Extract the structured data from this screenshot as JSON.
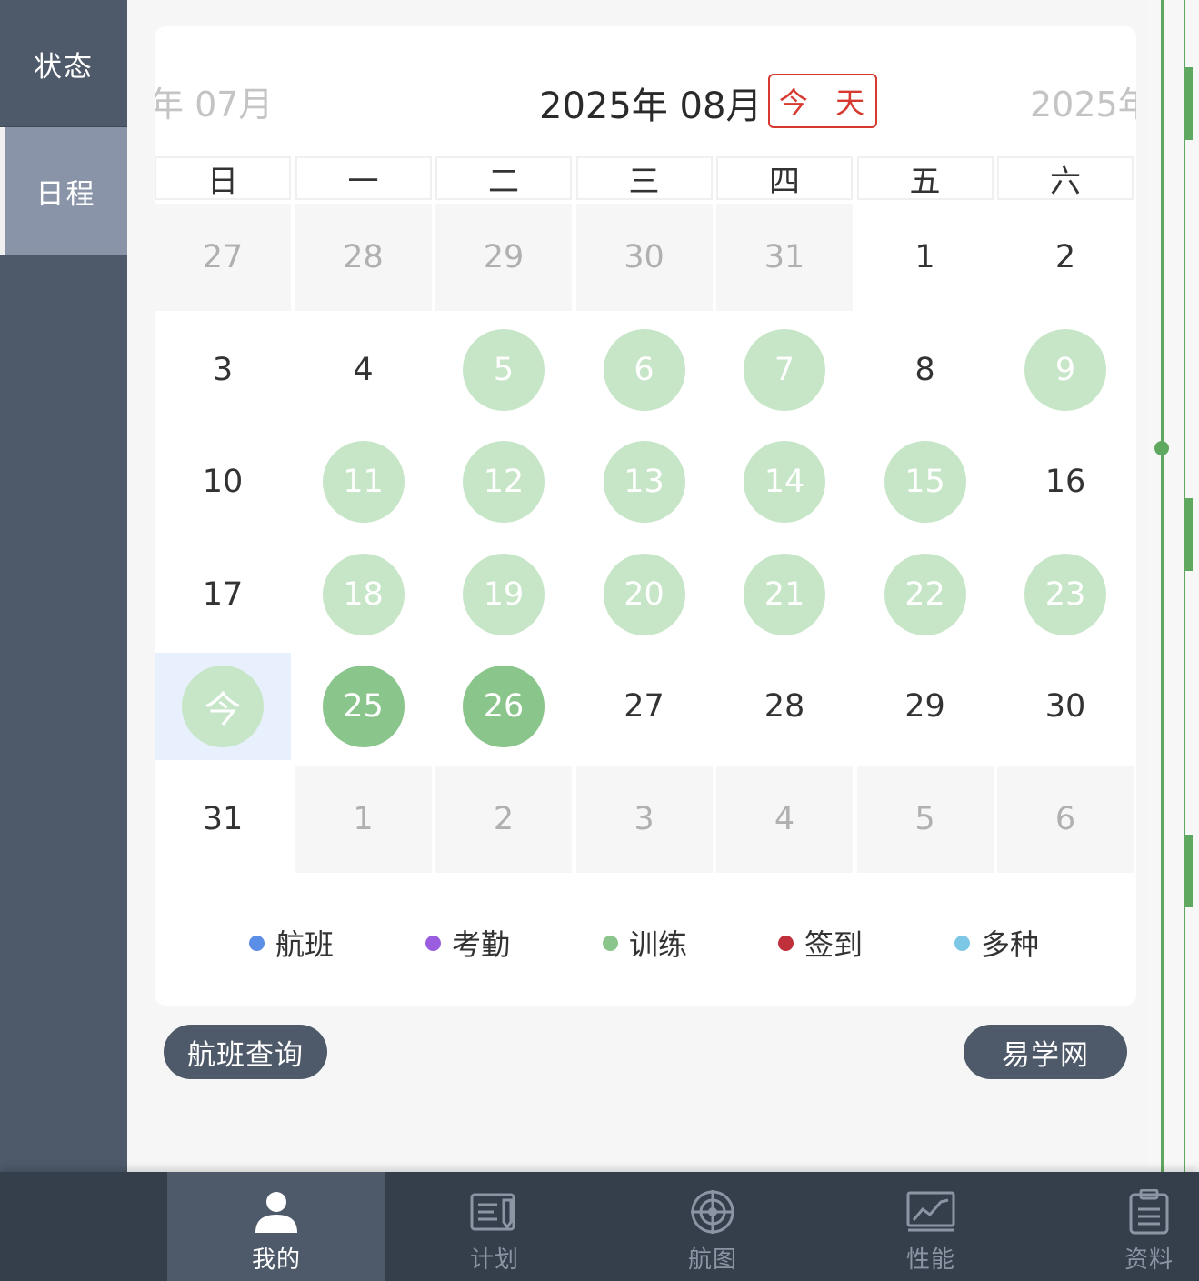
{
  "sidebar": {
    "items": [
      {
        "label": "状态"
      },
      {
        "label": "日程"
      }
    ]
  },
  "calendar": {
    "prev_month": "年 07月",
    "current_month": "2025年 08月",
    "next_month": "2025年",
    "today_button": "今 天",
    "weekdays": [
      "日",
      "一",
      "二",
      "三",
      "四",
      "五",
      "六"
    ],
    "rows": [
      [
        {
          "d": "27",
          "o": true
        },
        {
          "d": "28",
          "o": true
        },
        {
          "d": "29",
          "o": true
        },
        {
          "d": "30",
          "o": true
        },
        {
          "d": "31",
          "o": true
        },
        {
          "d": "1"
        },
        {
          "d": "2"
        }
      ],
      [
        {
          "d": "3"
        },
        {
          "d": "4"
        },
        {
          "d": "5",
          "m": "light"
        },
        {
          "d": "6",
          "m": "light"
        },
        {
          "d": "7",
          "m": "light"
        },
        {
          "d": "8"
        },
        {
          "d": "9",
          "m": "light"
        }
      ],
      [
        {
          "d": "10"
        },
        {
          "d": "11",
          "m": "light"
        },
        {
          "d": "12",
          "m": "light"
        },
        {
          "d": "13",
          "m": "light"
        },
        {
          "d": "14",
          "m": "light"
        },
        {
          "d": "15",
          "m": "light"
        },
        {
          "d": "16"
        }
      ],
      [
        {
          "d": "17"
        },
        {
          "d": "18",
          "m": "light"
        },
        {
          "d": "19",
          "m": "light"
        },
        {
          "d": "20",
          "m": "light"
        },
        {
          "d": "21",
          "m": "light"
        },
        {
          "d": "22",
          "m": "light"
        },
        {
          "d": "23",
          "m": "light"
        }
      ],
      [
        {
          "d": "今",
          "m": "todaymark",
          "today": true
        },
        {
          "d": "25",
          "m": "dark"
        },
        {
          "d": "26",
          "m": "dark"
        },
        {
          "d": "27"
        },
        {
          "d": "28"
        },
        {
          "d": "29"
        },
        {
          "d": "30"
        }
      ],
      [
        {
          "d": "31"
        },
        {
          "d": "1",
          "o": true
        },
        {
          "d": "2",
          "o": true
        },
        {
          "d": "3",
          "o": true
        },
        {
          "d": "4",
          "o": true
        },
        {
          "d": "5",
          "o": true
        },
        {
          "d": "6",
          "o": true
        }
      ]
    ]
  },
  "legend": [
    {
      "label": "航班",
      "color": "#5b8ee6"
    },
    {
      "label": "考勤",
      "color": "#9a5de0"
    },
    {
      "label": "训练",
      "color": "#8ac58b"
    },
    {
      "label": "签到",
      "color": "#c0303a"
    },
    {
      "label": "多种",
      "color": "#7cc6e6"
    }
  ],
  "actions": {
    "flight_query": "航班查询",
    "yixue": "易学网"
  },
  "tabs": [
    {
      "label": "我的",
      "icon": "person-icon",
      "active": true
    },
    {
      "label": "计划",
      "icon": "plan-icon"
    },
    {
      "label": "航图",
      "icon": "chart-target-icon"
    },
    {
      "label": "性能",
      "icon": "performance-icon"
    },
    {
      "label": "资料",
      "icon": "clipboard-icon"
    }
  ],
  "colors": {
    "accent_green": "#8ac58b",
    "light_green": "#c7e6c8",
    "today_red": "#d63a2f",
    "sidebar": "#4e5a6a",
    "tabbar": "#353f4c"
  }
}
